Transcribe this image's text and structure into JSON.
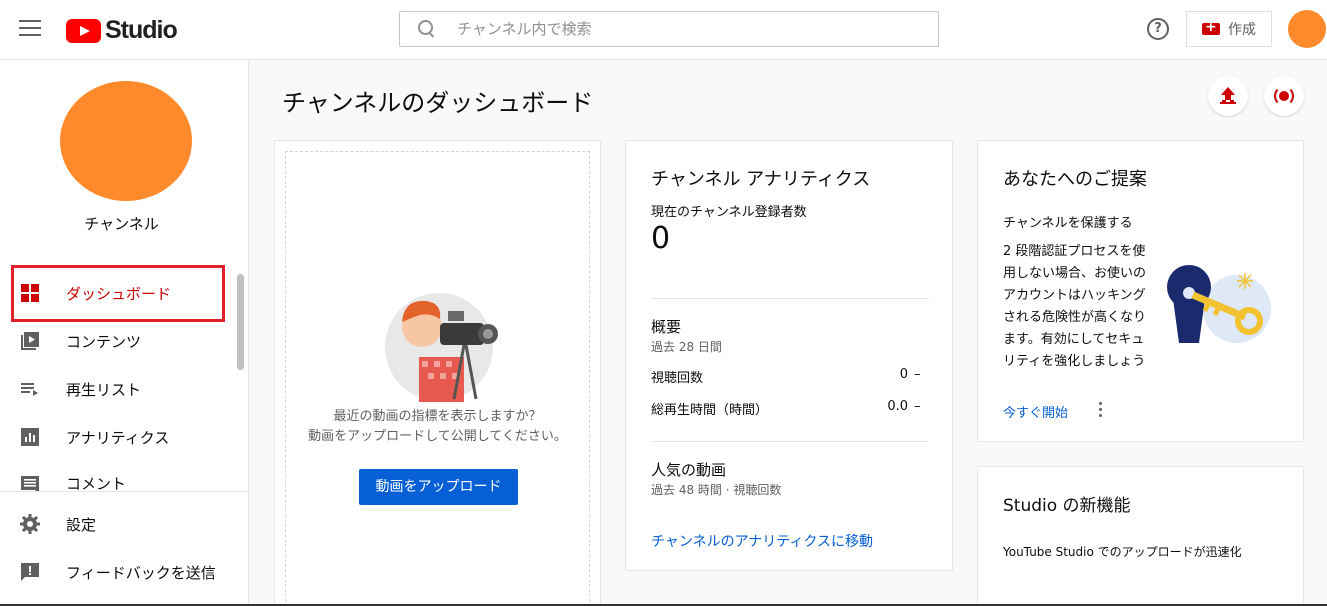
{
  "header": {
    "logo_text": "Studio",
    "search_placeholder": "チャンネル内で検索",
    "help_symbol": "?",
    "create_label": "作成"
  },
  "sidebar": {
    "channel_name": "チャンネル",
    "items": [
      {
        "label": "ダッシュボード",
        "icon": "dashboard-icon",
        "active": true
      },
      {
        "label": "コンテンツ",
        "icon": "content-icon"
      },
      {
        "label": "再生リスト",
        "icon": "playlist-icon"
      },
      {
        "label": "アナリティクス",
        "icon": "analytics-icon"
      },
      {
        "label": "コメント",
        "icon": "comment-icon"
      }
    ],
    "bottom_items": [
      {
        "label": "設定",
        "icon": "gear-icon"
      },
      {
        "label": "フィードバックを送信",
        "icon": "feedback-icon"
      }
    ]
  },
  "main": {
    "page_title": "チャンネルのダッシュボード",
    "upload_card": {
      "prompt_line1": "最近の動画の指標を表示しますか？",
      "prompt_line2": "動画をアップロードして公開してください。",
      "button_label": "動画をアップロード"
    },
    "analytics_card": {
      "title": "チャンネル アナリティクス",
      "subscribers_label": "現在のチャンネル登録者数",
      "subscribers_value": "0",
      "summary_title": "概要",
      "summary_period": "過去 28 日間",
      "views_label": "視聴回数",
      "views_value": "0",
      "views_change": "–",
      "watch_time_label": "総再生時間（時間）",
      "watch_time_value": "0.0",
      "watch_time_change": "–",
      "popular_title": "人気の動画",
      "popular_period": "過去 48 時間 · 視聴回数",
      "link_label": "チャンネルのアナリティクスに移動"
    },
    "suggestion_card": {
      "title": "あなたへのご提案",
      "subtitle": "チャンネルを保護する",
      "body": "2 段階認証プロセスを使用しない場合、お使いのアカウントはハッキングされる危険性が高くなります。有効にしてセキュリティを強化しましょう",
      "link_label": "今すぐ開始"
    },
    "whats_new_card": {
      "title": "Studio の新機能",
      "body": "YouTube Studio でのアップロードが迅速化"
    }
  },
  "colors": {
    "accent_red": "#cc0000",
    "link_blue": "#065fd4",
    "avatar_orange": "#ff8a2b"
  }
}
